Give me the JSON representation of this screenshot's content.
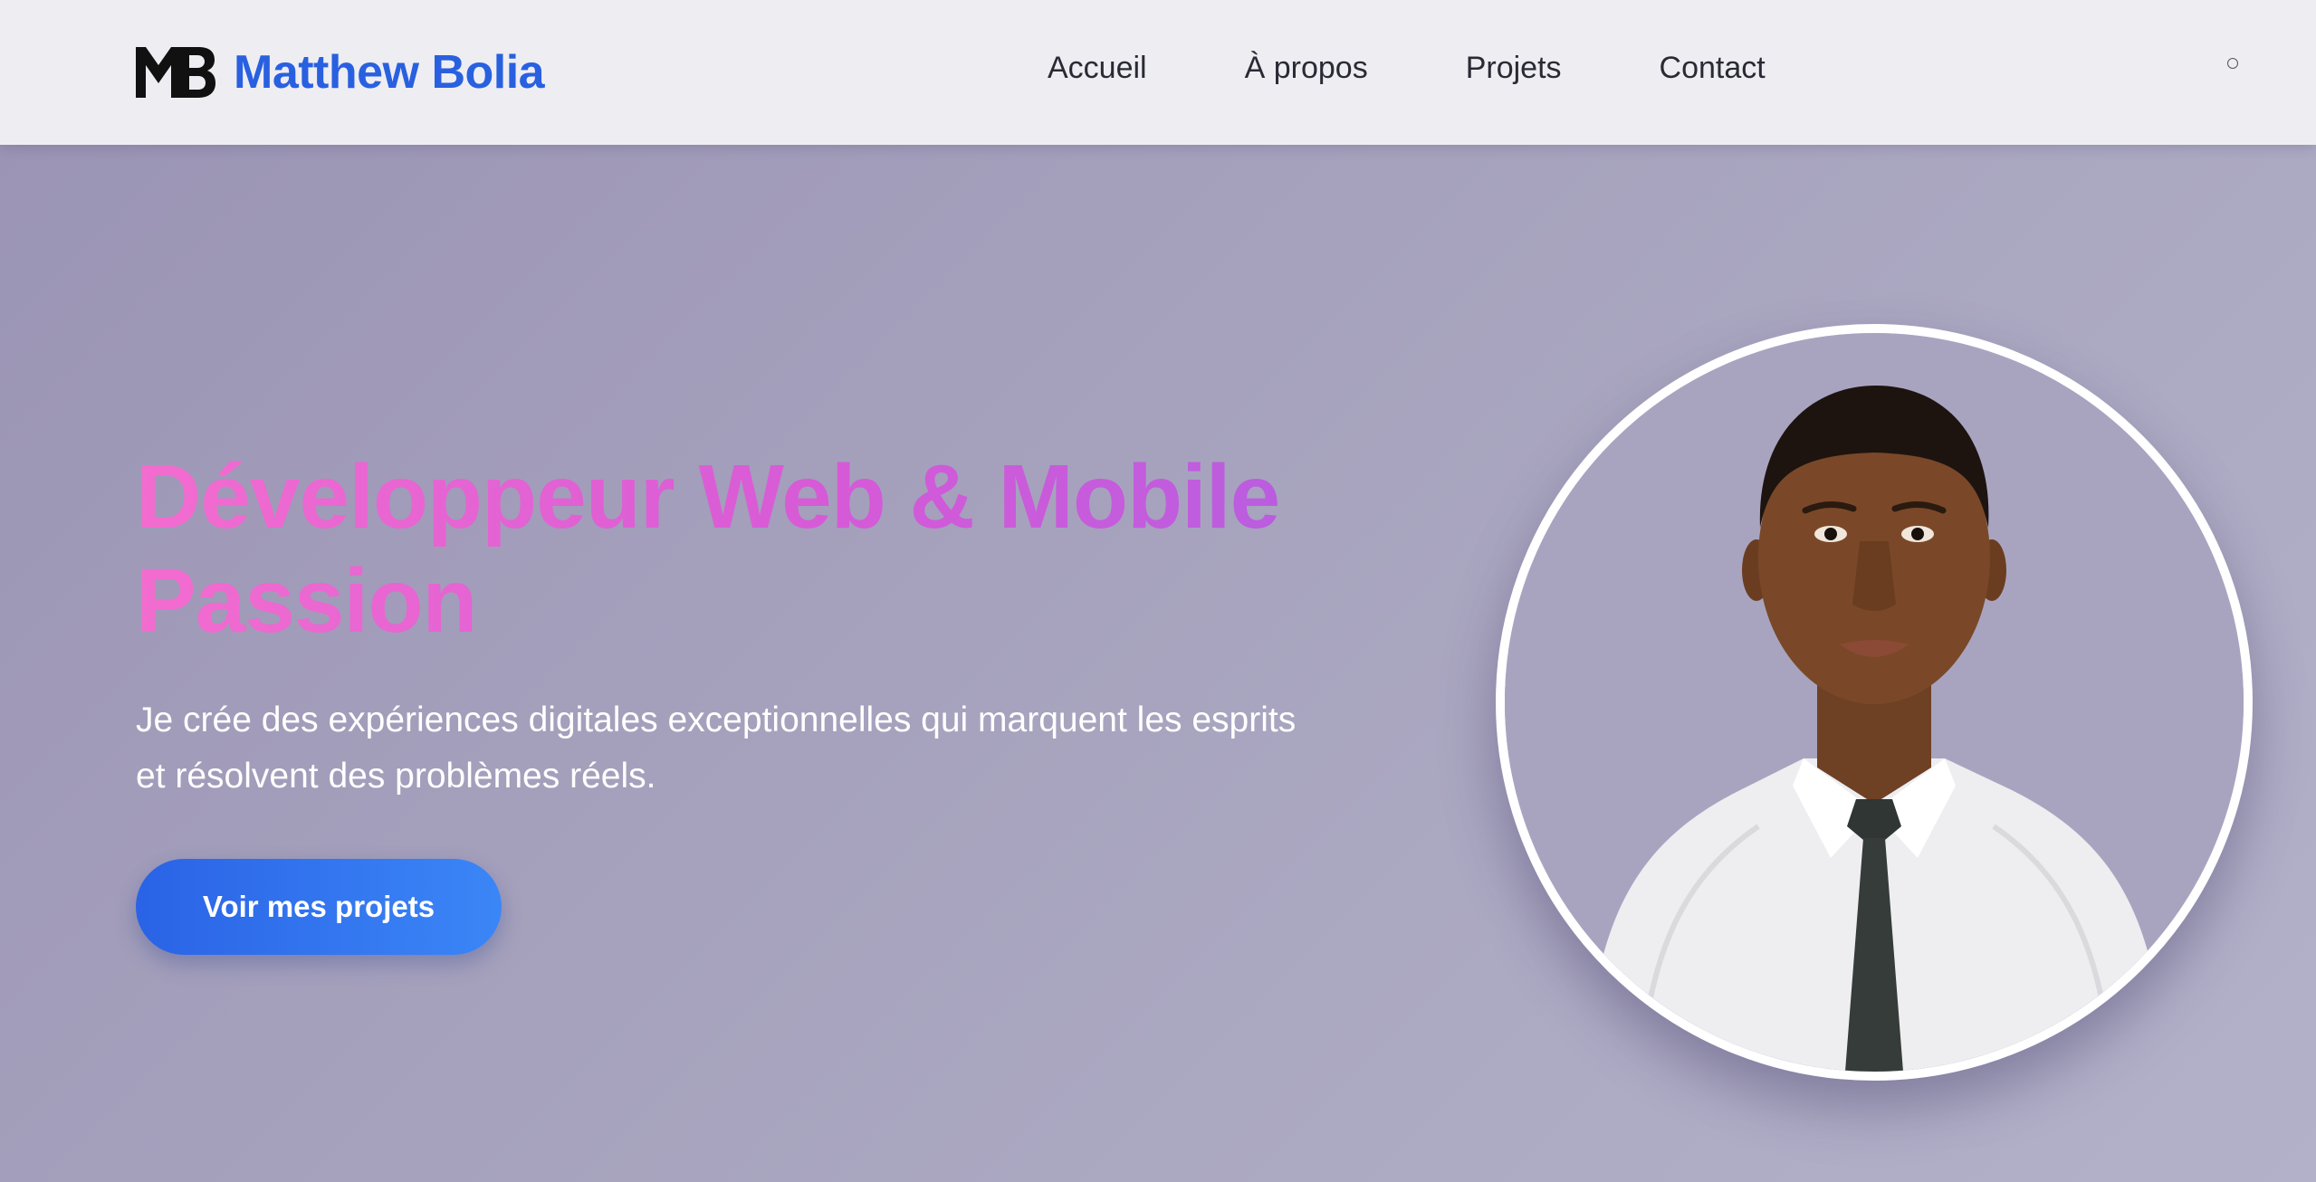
{
  "header": {
    "logo_icon": "mb-monogram-icon",
    "brand_name": "Matthew Bolia",
    "nav": [
      {
        "label": "Accueil"
      },
      {
        "label": "À propos"
      },
      {
        "label": "Projets"
      },
      {
        "label": "Contact"
      }
    ],
    "theme_toggle_icon": "circle-icon"
  },
  "hero": {
    "title_line1": "Développeur Web & Mobile",
    "title_line2": "Passion",
    "subtitle_line1": "Je crée des expériences digitales exceptionnelles qui marquent les esprits",
    "subtitle_line2": "et résolvent des problèmes réels.",
    "cta_label": "Voir mes projets",
    "portrait_image": "profile-photo"
  },
  "colors": {
    "brand": "#2860e0",
    "title_gradient_start": "#f36ccf",
    "title_gradient_end": "#b35de2",
    "cta_start": "#2a63e6",
    "cta_end": "#3b86f7",
    "header_bg": "#eeedf2",
    "hero_bg": "#a6a2bd"
  }
}
